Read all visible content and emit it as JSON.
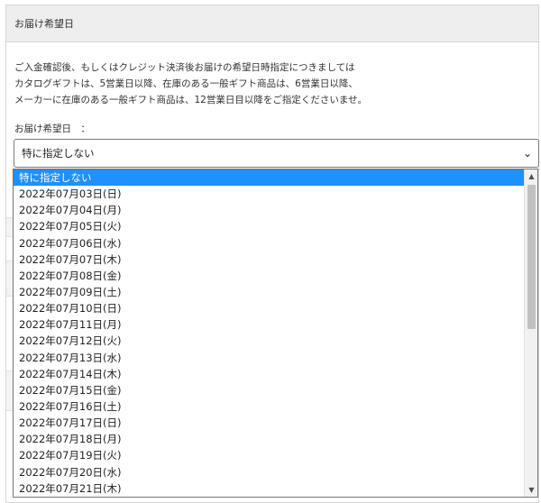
{
  "panel": {
    "header": "お届け希望日",
    "notice_lines": [
      "ご入金確認後、もしくはクレジット決済後お届けの希望日時指定につきましては",
      "カタログギフトは、5営業日以降、在庫のある一般ギフト商品は、6営業日以降、",
      "メーカーに在庫のある一般ギフト商品は、12営業日目以降をご指定くださいませ。"
    ],
    "field_label": "お届け希望日　："
  },
  "select": {
    "current_value": "特に指定しない",
    "arrow_icon": "chevron-down-icon"
  },
  "dropdown": {
    "options": [
      "特に指定しない",
      "2022年07月03日(日)",
      "2022年07月04日(月)",
      "2022年07月05日(火)",
      "2022年07月06日(水)",
      "2022年07月07日(木)",
      "2022年07月08日(金)",
      "2022年07月09日(土)",
      "2022年07月10日(日)",
      "2022年07月11日(月)",
      "2022年07月12日(火)",
      "2022年07月13日(水)",
      "2022年07月14日(木)",
      "2022年07月15日(金)",
      "2022年07月16日(土)",
      "2022年07月17日(日)",
      "2022年07月18日(月)",
      "2022年07月19日(火)",
      "2022年07月20日(水)",
      "2022年07月21日(木)"
    ],
    "selected_index": 0,
    "highlight_color": "#1e90ff"
  }
}
